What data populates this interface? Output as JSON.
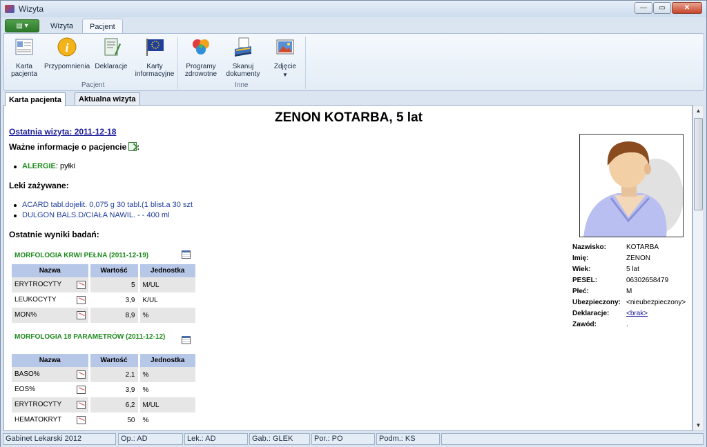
{
  "window": {
    "title": "Wizyta",
    "buttons": [
      "minimize",
      "maximize",
      "close"
    ]
  },
  "ribbon": {
    "tabs": [
      "Wizyta",
      "Pacjent"
    ],
    "active_tab": "Pacjent",
    "groups": [
      {
        "label": "Pacjent",
        "buttons": [
          {
            "label1": "Karta",
            "label2": "pacjenta",
            "icon": "patient-card-icon"
          },
          {
            "label1": "Przypomnienia",
            "label2": "",
            "icon": "info-icon"
          },
          {
            "label1": "Deklaracje",
            "label2": "",
            "icon": "declaration-icon"
          },
          {
            "label1": "Karty",
            "label2": "informacyjne",
            "icon": "eu-flag-icon"
          }
        ]
      },
      {
        "label": "Inne",
        "buttons": [
          {
            "label1": "Programy",
            "label2": "zdrowotne",
            "icon": "health-programs-icon"
          },
          {
            "label1": "Skanuj",
            "label2": "dokumenty",
            "icon": "scanner-icon"
          },
          {
            "label1": "Zdjęcie",
            "label2": "",
            "icon": "photo-icon"
          }
        ]
      }
    ]
  },
  "doc_tabs": [
    "Karta pacjenta",
    "Aktualna wizyta"
  ],
  "patient": {
    "title": "ZENON KOTARBA, 5 lat",
    "last_visit": "Ostatnia wizyta: 2011-12-18",
    "important_header": "Ważne informacje o pacjencie",
    "important_suffix": ":",
    "allergy_label": "ALERGIE",
    "allergy_value": ": pyłki",
    "meds_header": "Leki zażywane:",
    "meds": [
      "ACARD tabl.dojelit. 0,075 g 30 tabl.(1 blist.a 30 szt",
      "DULGON BALS.D/CIAŁA NAWIL. - - 400 ml"
    ],
    "results_header": "Ostatnie wyniki badań:"
  },
  "labs": [
    {
      "title": "MORFOLOGIA KRWI PEŁNA (2011-12-19)",
      "columns": [
        "Nazwa",
        "Wartość",
        "Jednostka"
      ],
      "rows": [
        {
          "name": "ERYTROCYTY",
          "value": "5",
          "unit": "M/UL"
        },
        {
          "name": "LEUKOCYTY",
          "value": "3,9",
          "unit": "K/UL"
        },
        {
          "name": "MON%",
          "value": "8,9",
          "unit": "%"
        }
      ]
    },
    {
      "title": "MORFOLOGIA 18 PARAMETRÓW (2011-12-12)",
      "columns": [
        "Nazwa",
        "Wartość",
        "Jednostka"
      ],
      "rows": [
        {
          "name": "BASO%",
          "value": "2,1",
          "unit": "%"
        },
        {
          "name": "EOS%",
          "value": "3,9",
          "unit": "%"
        },
        {
          "name": "ERYTROCYTY",
          "value": "6,2",
          "unit": "M/UL"
        },
        {
          "name": "HEMATOKRYT",
          "value": "50",
          "unit": "%"
        }
      ]
    }
  ],
  "patient_info": {
    "labels": [
      "Nazwisko:",
      "Imię:",
      "Wiek:",
      "PESEL:",
      "Płeć:",
      "Ubezpieczony:",
      "Deklaracje:",
      "Zawód:"
    ],
    "values": [
      "KOTARBA",
      "ZENON",
      "5 lat",
      "06302658479",
      "M",
      "<nieubezpieczony>",
      "<brak>",
      "."
    ]
  },
  "statusbar": [
    "Gabinet Lekarski 2012",
    "Op.: AD",
    "Lek.: AD",
    "Gab.: GLEK",
    "Por.: PO",
    "Podm.: KS",
    ""
  ]
}
